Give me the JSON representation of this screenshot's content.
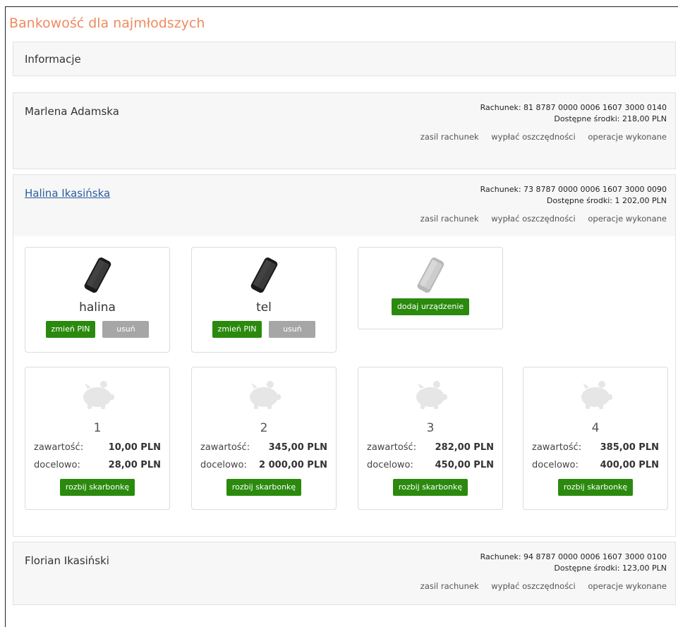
{
  "page": {
    "title": "Bankowość dla najmłodszych"
  },
  "info": {
    "label": "Informacje"
  },
  "labels": {
    "account": "Rachunek:",
    "available": "Dostępne środki:",
    "fund": "zasil rachunek",
    "withdraw": "wypłać oszczędności",
    "operations": "operacje wykonane",
    "change_pin": "zmień PIN",
    "remove": "usuń",
    "add_device": "dodaj urządzenie",
    "content": "zawartość:",
    "target": "docelowo:",
    "break_piggy": "rozbij skarbonkę"
  },
  "accounts": [
    {
      "name": "Marlena Adamska",
      "number": "81 8787 0000 0006 1607 3000 0140",
      "balance": "218,00 PLN"
    },
    {
      "name": "Halina Ikasińska",
      "number": "73 8787 0000 0006 1607 3000 0090",
      "balance": "1 202,00 PLN"
    },
    {
      "name": "Florian Ikasiński",
      "number": "94 8787 0000 0006 1607 3000 0100",
      "balance": "123,00 PLN"
    }
  ],
  "devices": [
    {
      "name": "halina"
    },
    {
      "name": "tel"
    }
  ],
  "piggybanks": [
    {
      "number": "1",
      "content": "10,00 PLN",
      "target": "28,00 PLN"
    },
    {
      "number": "2",
      "content": "345,00 PLN",
      "target": "2 000,00 PLN"
    },
    {
      "number": "3",
      "content": "282,00 PLN",
      "target": "450,00 PLN"
    },
    {
      "number": "4",
      "content": "385,00 PLN",
      "target": "400,00 PLN"
    }
  ],
  "colors": {
    "accent": "#ef8a5f",
    "button_green": "#2b8a0e",
    "button_grey": "#a6a6a6",
    "link": "#2a5d9f"
  }
}
